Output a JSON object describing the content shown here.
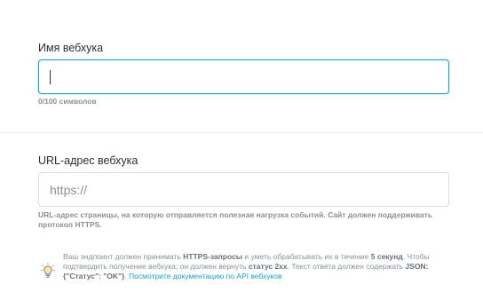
{
  "webhook_name": {
    "label": "Имя вебхука",
    "value": "",
    "counter": "0/100 символов"
  },
  "webhook_url": {
    "label": "URL-адрес вебхука",
    "placeholder": "https://",
    "hint": "URL-адрес страницы, на которую отправляется полезная нагрузка событий. Сайт должен поддерживать протокол HTTPS."
  },
  "info": {
    "icon": "lightbulb-icon",
    "t1": "Ваш эндпоинт должен принимать ",
    "b1": "HTTPS-запросы",
    "t2": " и уметь обрабатывать их в течение ",
    "b2": "5 секунд",
    "t3": ". Чтобы подтвердить получение вебхука, он должен вернуть ",
    "b3": "статус 2xx",
    "t4": ". Текст ответа должен содержать ",
    "b4": "JSON: {\"Статус\": \"OK\"}",
    "t5": ". ",
    "link": "Посмотрите документацию по API вебхуков"
  }
}
